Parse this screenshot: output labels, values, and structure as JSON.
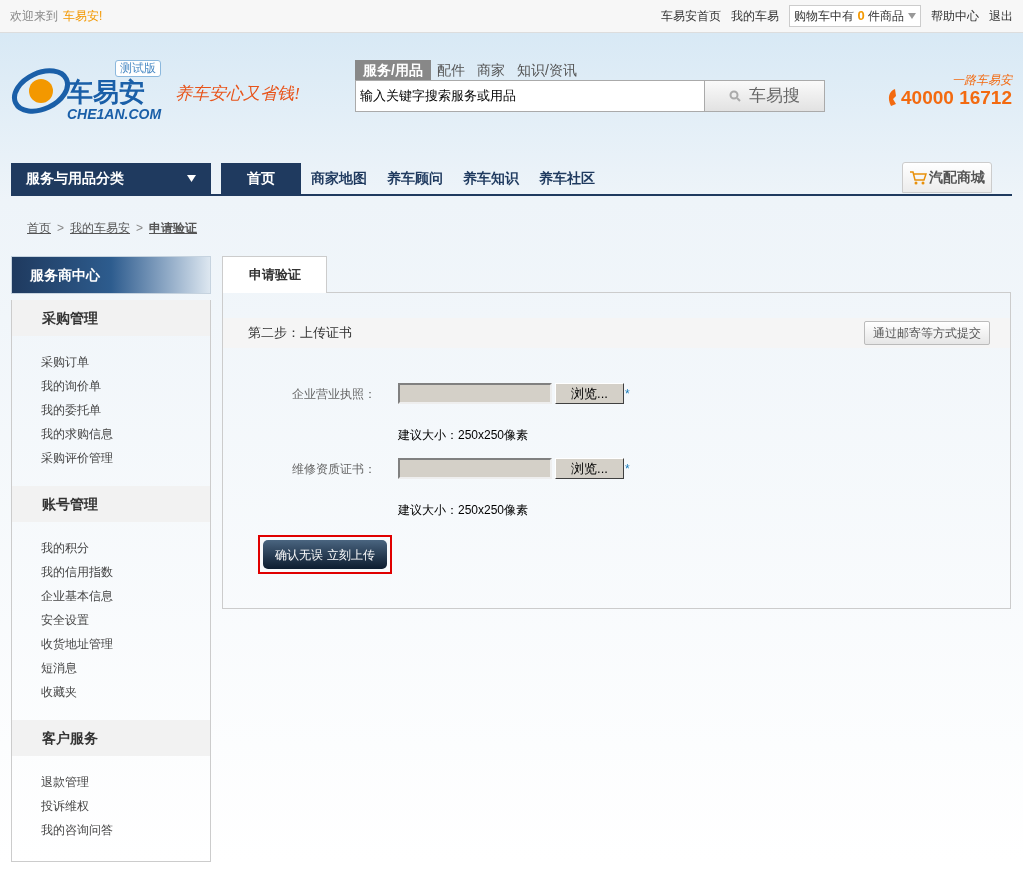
{
  "top_bar": {
    "welcome": "欢迎来到",
    "site": "车易安!",
    "links": [
      "车易安首页",
      "我的车易"
    ],
    "cart": {
      "prefix": "购物车中有",
      "count": "0",
      "suffix": "件商品"
    },
    "right_links": [
      "帮助中心",
      "退出"
    ]
  },
  "header": {
    "logo": {
      "badge": "测试版",
      "name": "车易安",
      "domain": "CHE1AN.COM"
    },
    "slogan": "养车安心又省钱!",
    "search_tabs": [
      {
        "label": "服务/用品",
        "selected": true
      },
      {
        "label": "配件",
        "selected": false
      },
      {
        "label": "商家",
        "selected": false
      },
      {
        "label": "知识/资讯",
        "selected": false
      }
    ],
    "search": {
      "value": "输入关键字搜索服务或用品",
      "button": "车易搜"
    },
    "hotline": {
      "caption": "一路车易安",
      "number": "40000 16712"
    }
  },
  "nav": {
    "category": "服务与用品分类",
    "items": [
      {
        "label": "首页",
        "selected": true
      },
      {
        "label": "商家地图",
        "selected": false
      },
      {
        "label": "养车顾问",
        "selected": false
      },
      {
        "label": "养车知识",
        "selected": false
      },
      {
        "label": "养车社区",
        "selected": false
      }
    ],
    "shop": "汽配商城"
  },
  "breadcrumb": {
    "separator": ">",
    "items": [
      "首页",
      "我的车易安",
      "申请验证"
    ]
  },
  "sidebar": {
    "title": "服务商中心",
    "groups": [
      {
        "title": "采购管理",
        "items": [
          "采购订单",
          "我的询价单",
          "我的委托单",
          "我的求购信息",
          "采购评价管理"
        ]
      },
      {
        "title": "账号管理",
        "items": [
          "我的积分",
          "我的信用指数",
          "企业基本信息",
          "安全设置",
          "收货地址管理",
          "短消息",
          "收藏夹"
        ]
      },
      {
        "title": "客户服务",
        "items": [
          "退款管理",
          "投诉维权",
          "我的咨询问答"
        ]
      }
    ]
  },
  "main": {
    "tab": "申请验证",
    "step": "第二步：上传证书",
    "mail_button": "通过邮寄等方式提交",
    "uploads": [
      {
        "label": "企业营业执照：",
        "browse": "浏览...",
        "required": "*",
        "hint": "建议大小：250x250像素"
      },
      {
        "label": "维修资质证书：",
        "browse": "浏览...",
        "required": "*",
        "hint": "建议大小：250x250像素"
      }
    ],
    "submit": "确认无误 立刻上传"
  }
}
